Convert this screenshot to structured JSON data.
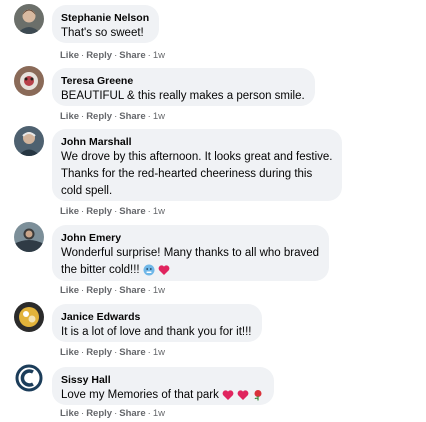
{
  "comments": [
    {
      "name": "Stephanie Nelson",
      "lines": [
        "That's so sweet!"
      ],
      "actions": {
        "like": "Like",
        "reply": "Reply",
        "share": "Share",
        "time": "1w"
      }
    },
    {
      "name": "Teresa Greene",
      "lines": [
        "BEAUTIFUL & this really makes a person smile."
      ],
      "actions": {
        "like": "Like",
        "reply": "Reply",
        "share": "Share",
        "time": "1w"
      }
    },
    {
      "name": "John Marshall",
      "lines": [
        "We drove by this afternoon. It looks great and festive.",
        "Thanks for the red-hearted cheeriness during this",
        "cold spell."
      ],
      "actions": {
        "like": "Like",
        "reply": "Reply",
        "share": "Share",
        "time": "1w"
      }
    },
    {
      "name": "John Emery",
      "lines": [
        "Wonderful surprise! Many thanks to all who braved",
        "the bitter cold!!!"
      ],
      "emojis": [
        "cold-face-emoji",
        "red-heart-emoji"
      ],
      "actions": {
        "like": "Like",
        "reply": "Reply",
        "share": "Share",
        "time": "1w"
      }
    },
    {
      "name": "Janice Edwards",
      "lines": [
        "It is a lot of love and thank you for it!!!"
      ],
      "actions": {
        "like": "Like",
        "reply": "Reply",
        "share": "Share",
        "time": "1w"
      }
    },
    {
      "name": "Sissy Hall",
      "lines": [
        "Love my Memories of that park"
      ],
      "emojis": [
        "red-heart-emoji",
        "red-heart-emoji",
        "rose-emoji"
      ],
      "actions": {
        "like": "Like",
        "reply": "Reply",
        "share": "Share",
        "time": "1w"
      }
    }
  ],
  "separator": "·",
  "colors": {
    "bubble": "#f0f2f5",
    "meta": "#65676b",
    "text": "#050505",
    "heart": "#e0245e"
  }
}
